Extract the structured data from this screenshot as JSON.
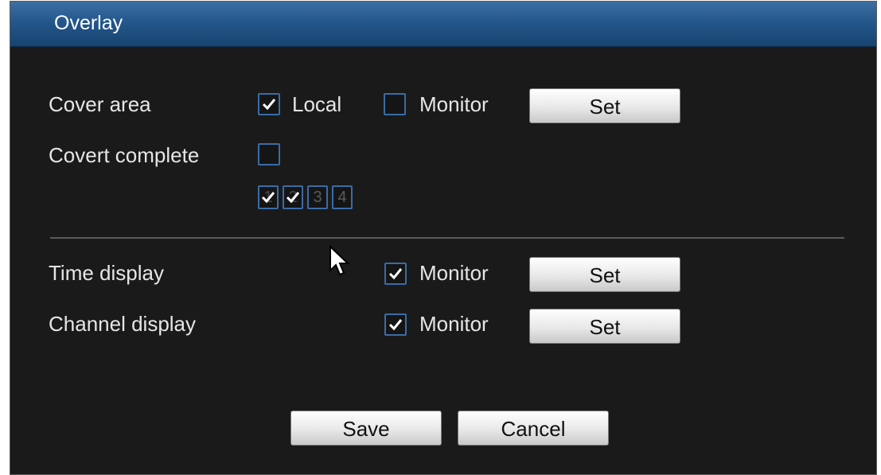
{
  "window": {
    "title": "Overlay"
  },
  "cover_area": {
    "label": "Cover area",
    "local_label": "Local",
    "local_checked": true,
    "monitor_label": "Monitor",
    "monitor_checked": false,
    "set_label": "Set"
  },
  "covert_complete": {
    "label": "Covert complete",
    "checked": false,
    "channels": [
      {
        "number": "1",
        "checked": true
      },
      {
        "number": "2",
        "checked": true
      },
      {
        "number": "3",
        "checked": false
      },
      {
        "number": "4",
        "checked": false
      }
    ]
  },
  "time_display": {
    "label": "Time display",
    "monitor_label": "Monitor",
    "monitor_checked": true,
    "set_label": "Set"
  },
  "channel_display": {
    "label": "Channel display",
    "monitor_label": "Monitor",
    "monitor_checked": true,
    "set_label": "Set"
  },
  "footer": {
    "save_label": "Save",
    "cancel_label": "Cancel"
  },
  "colors": {
    "title_bar": "#24578c",
    "background": "#1a1a1a",
    "checkbox_border": "#3a6ca6"
  }
}
